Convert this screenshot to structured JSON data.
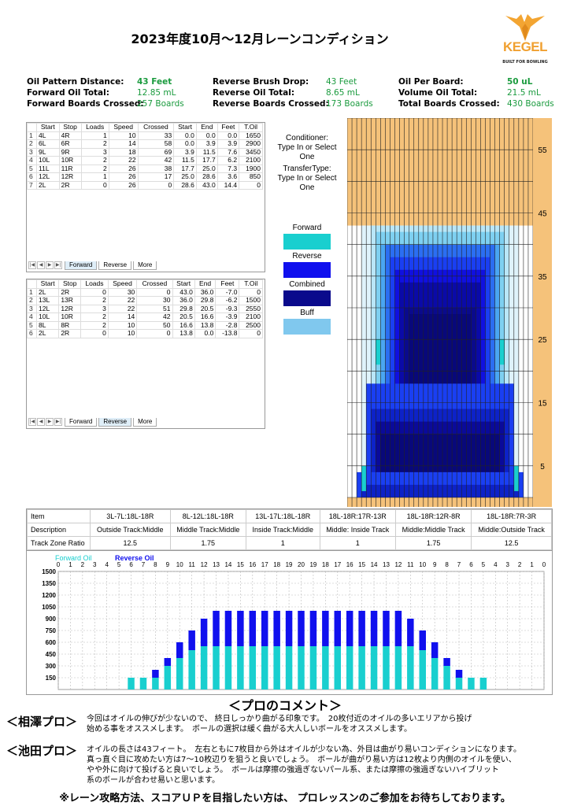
{
  "title": "2023年度10月～12月レーンコンディション",
  "logo": {
    "brand": "KEGEL",
    "tagline": "BUILT FOR BOWLING"
  },
  "info": [
    [
      {
        "label": "Oil Pattern Distance:",
        "value": "43 Feet",
        "bold": true
      },
      {
        "label": "Reverse Brush Drop:",
        "value": "43 Feet"
      },
      {
        "label": "Oil Per Board:",
        "value": "50 uL",
        "bold": true
      }
    ],
    [
      {
        "label": "Forward Oil Total:",
        "value": "12.85 mL"
      },
      {
        "label": "Reverse Oil Total:",
        "value": "8.65 mL"
      },
      {
        "label": "Volume Oil Total:",
        "value": "21.5 mL"
      }
    ],
    [
      {
        "label": "Forward Boards Crossed:",
        "value": "257 Boards"
      },
      {
        "label": "Reverse Boards Crossed:",
        "value": "173 Boards"
      },
      {
        "label": "Total Boards Crossed:",
        "value": "430 Boards"
      }
    ]
  ],
  "table_headers": [
    "",
    "Start",
    "Stop",
    "Loads",
    "Speed",
    "Crossed",
    "Start",
    "End",
    "Feet",
    "T.Oil"
  ],
  "forward_rows": [
    [
      "1",
      "4L",
      "4R",
      "1",
      "10",
      "33",
      "0.0",
      "0.0",
      "0.0",
      "1650"
    ],
    [
      "2",
      "6L",
      "6R",
      "2",
      "14",
      "58",
      "0.0",
      "3.9",
      "3.9",
      "2900"
    ],
    [
      "3",
      "9L",
      "9R",
      "3",
      "18",
      "69",
      "3.9",
      "11.5",
      "7.6",
      "3450"
    ],
    [
      "4",
      "10L",
      "10R",
      "2",
      "22",
      "42",
      "11.5",
      "17.7",
      "6.2",
      "2100"
    ],
    [
      "5",
      "11L",
      "11R",
      "2",
      "26",
      "38",
      "17.7",
      "25.0",
      "7.3",
      "1900"
    ],
    [
      "6",
      "12L",
      "12R",
      "1",
      "26",
      "17",
      "25.0",
      "28.6",
      "3.6",
      "850"
    ],
    [
      "7",
      "2L",
      "2R",
      "0",
      "26",
      "0",
      "28.6",
      "43.0",
      "14.4",
      "0"
    ]
  ],
  "reverse_rows": [
    [
      "1",
      "2L",
      "2R",
      "0",
      "30",
      "0",
      "43.0",
      "36.0",
      "-7.0",
      "0"
    ],
    [
      "2",
      "13L",
      "13R",
      "2",
      "22",
      "30",
      "36.0",
      "29.8",
      "-6.2",
      "1500"
    ],
    [
      "3",
      "12L",
      "12R",
      "3",
      "22",
      "51",
      "29.8",
      "20.5",
      "-9.3",
      "2550"
    ],
    [
      "4",
      "10L",
      "10R",
      "2",
      "14",
      "42",
      "20.5",
      "16.6",
      "-3.9",
      "2100"
    ],
    [
      "5",
      "8L",
      "8R",
      "2",
      "10",
      "50",
      "16.6",
      "13.8",
      "-2.8",
      "2500"
    ],
    [
      "6",
      "2L",
      "2R",
      "0",
      "10",
      "0",
      "13.8",
      "0.0",
      "-13.8",
      "0"
    ]
  ],
  "tabs": {
    "forward": "Forward",
    "reverse": "Reverse",
    "more": "More"
  },
  "conditioner": {
    "line1": "Conditioner:",
    "line2": "Type In or Select",
    "line3": "One"
  },
  "transfer": {
    "line1": "TransferType:",
    "line2": "Type In or Select",
    "line3": "One"
  },
  "legend": [
    {
      "label": "Forward",
      "color": "#19cfcf"
    },
    {
      "label": "Reverse",
      "color": "#1010ee"
    },
    {
      "label": "Combined",
      "color": "#0a0a8c"
    },
    {
      "label": "Buff",
      "color": "#80c8ee"
    }
  ],
  "lane_labels": [
    "55",
    "45",
    "35",
    "25",
    "15",
    "5"
  ],
  "zone": {
    "row_labels": [
      "Item",
      "Description",
      "Track Zone Ratio"
    ],
    "columns": [
      {
        "item": "3L-7L:18L-18R",
        "desc": "Outside Track:Middle",
        "ratio": "12.5"
      },
      {
        "item": "8L-12L:18L-18R",
        "desc": "Middle Track:Middle",
        "ratio": "1.75"
      },
      {
        "item": "13L-17L:18L-18R",
        "desc": "Inside Track:Middle",
        "ratio": "1"
      },
      {
        "item": "18L-18R:17R-13R",
        "desc": "Middle: Inside Track",
        "ratio": "1"
      },
      {
        "item": "18L-18R:12R-8R",
        "desc": "Middle:Middle Track",
        "ratio": "1.75"
      },
      {
        "item": "18L-18R:7R-3R",
        "desc": "Middle:Outside Track",
        "ratio": "12.5"
      }
    ]
  },
  "comments": {
    "heading": "＜プロのコメント＞",
    "p1_name": "＜相澤プロ＞",
    "p1_l1": "今回はオイルの伸びが少ないので、 終日しっかり曲がる印象です。　20枚付近のオイルの多いエリアから投げ",
    "p1_l2": "始める事をオススメします。　ボールの選択は緩く曲がる大人しいボールをオススメします。",
    "p2_name": "＜池田プロ＞",
    "p2_l1": "オイルの長さは43フィート。　左右ともに7枚目から外はオイルが少ない為、外目は曲がり易いコンディションになります。",
    "p2_l2": "真っ直ぐ目に攻めたい方は7～10枚辺りを狙うと良いでしょう。　ボールが曲がり易い方は12枚より内側のオイルを使い、",
    "p2_l3": "やや外に向けて投げると良いでしょう。　ボールは摩擦の強過ぎないパール系、または摩擦の強過ぎないハイブリット",
    "p2_l4": "系のボールが合わせ易いと思います。",
    "footer": "※レーン攻略方法、スコアＵＰを目指したい方は、 プロレッスンのご参加をお待ちしております。"
  },
  "chart_data": {
    "type": "bar",
    "title": "",
    "xlabel": "",
    "ylabel": "",
    "x_ticks": [
      "0",
      "1",
      "2",
      "3",
      "4",
      "5",
      "6",
      "7",
      "8",
      "9",
      "10",
      "11",
      "12",
      "13",
      "14",
      "15",
      "16",
      "17",
      "18",
      "19",
      "20",
      "19",
      "18",
      "17",
      "16",
      "15",
      "14",
      "13",
      "12",
      "11",
      "10",
      "9",
      "8",
      "7",
      "6",
      "5",
      "4",
      "3",
      "2",
      "1",
      "0"
    ],
    "ylim": [
      0,
      1500
    ],
    "y_ticks": [
      150,
      300,
      450,
      600,
      750,
      900,
      1050,
      1200,
      1350,
      1500
    ],
    "series": [
      {
        "name": "Forward Oil",
        "color": "#19cfcf",
        "values": [
          0,
          0,
          0,
          0,
          0,
          0,
          150,
          150,
          150,
          300,
          400,
          500,
          550,
          550,
          550,
          550,
          550,
          550,
          550,
          550,
          550,
          550,
          550,
          550,
          550,
          550,
          550,
          550,
          550,
          550,
          500,
          400,
          300,
          150,
          150,
          150,
          0,
          0,
          0,
          0,
          0
        ]
      },
      {
        "name": "Reverse Oil",
        "color": "#1010ee",
        "values": [
          0,
          0,
          0,
          0,
          0,
          0,
          0,
          0,
          100,
          100,
          200,
          250,
          350,
          450,
          450,
          450,
          450,
          450,
          450,
          450,
          450,
          450,
          450,
          450,
          450,
          450,
          450,
          450,
          450,
          350,
          250,
          200,
          100,
          100,
          0,
          0,
          0,
          0,
          0,
          0,
          0
        ]
      }
    ],
    "legend": "top-left",
    "grid": true
  },
  "lane_data": {
    "boards": 39,
    "forward_cyan_marks": [
      [
        6,
        25
      ],
      [
        32,
        25
      ],
      [
        3,
        5
      ],
      [
        35,
        5
      ]
    ]
  }
}
